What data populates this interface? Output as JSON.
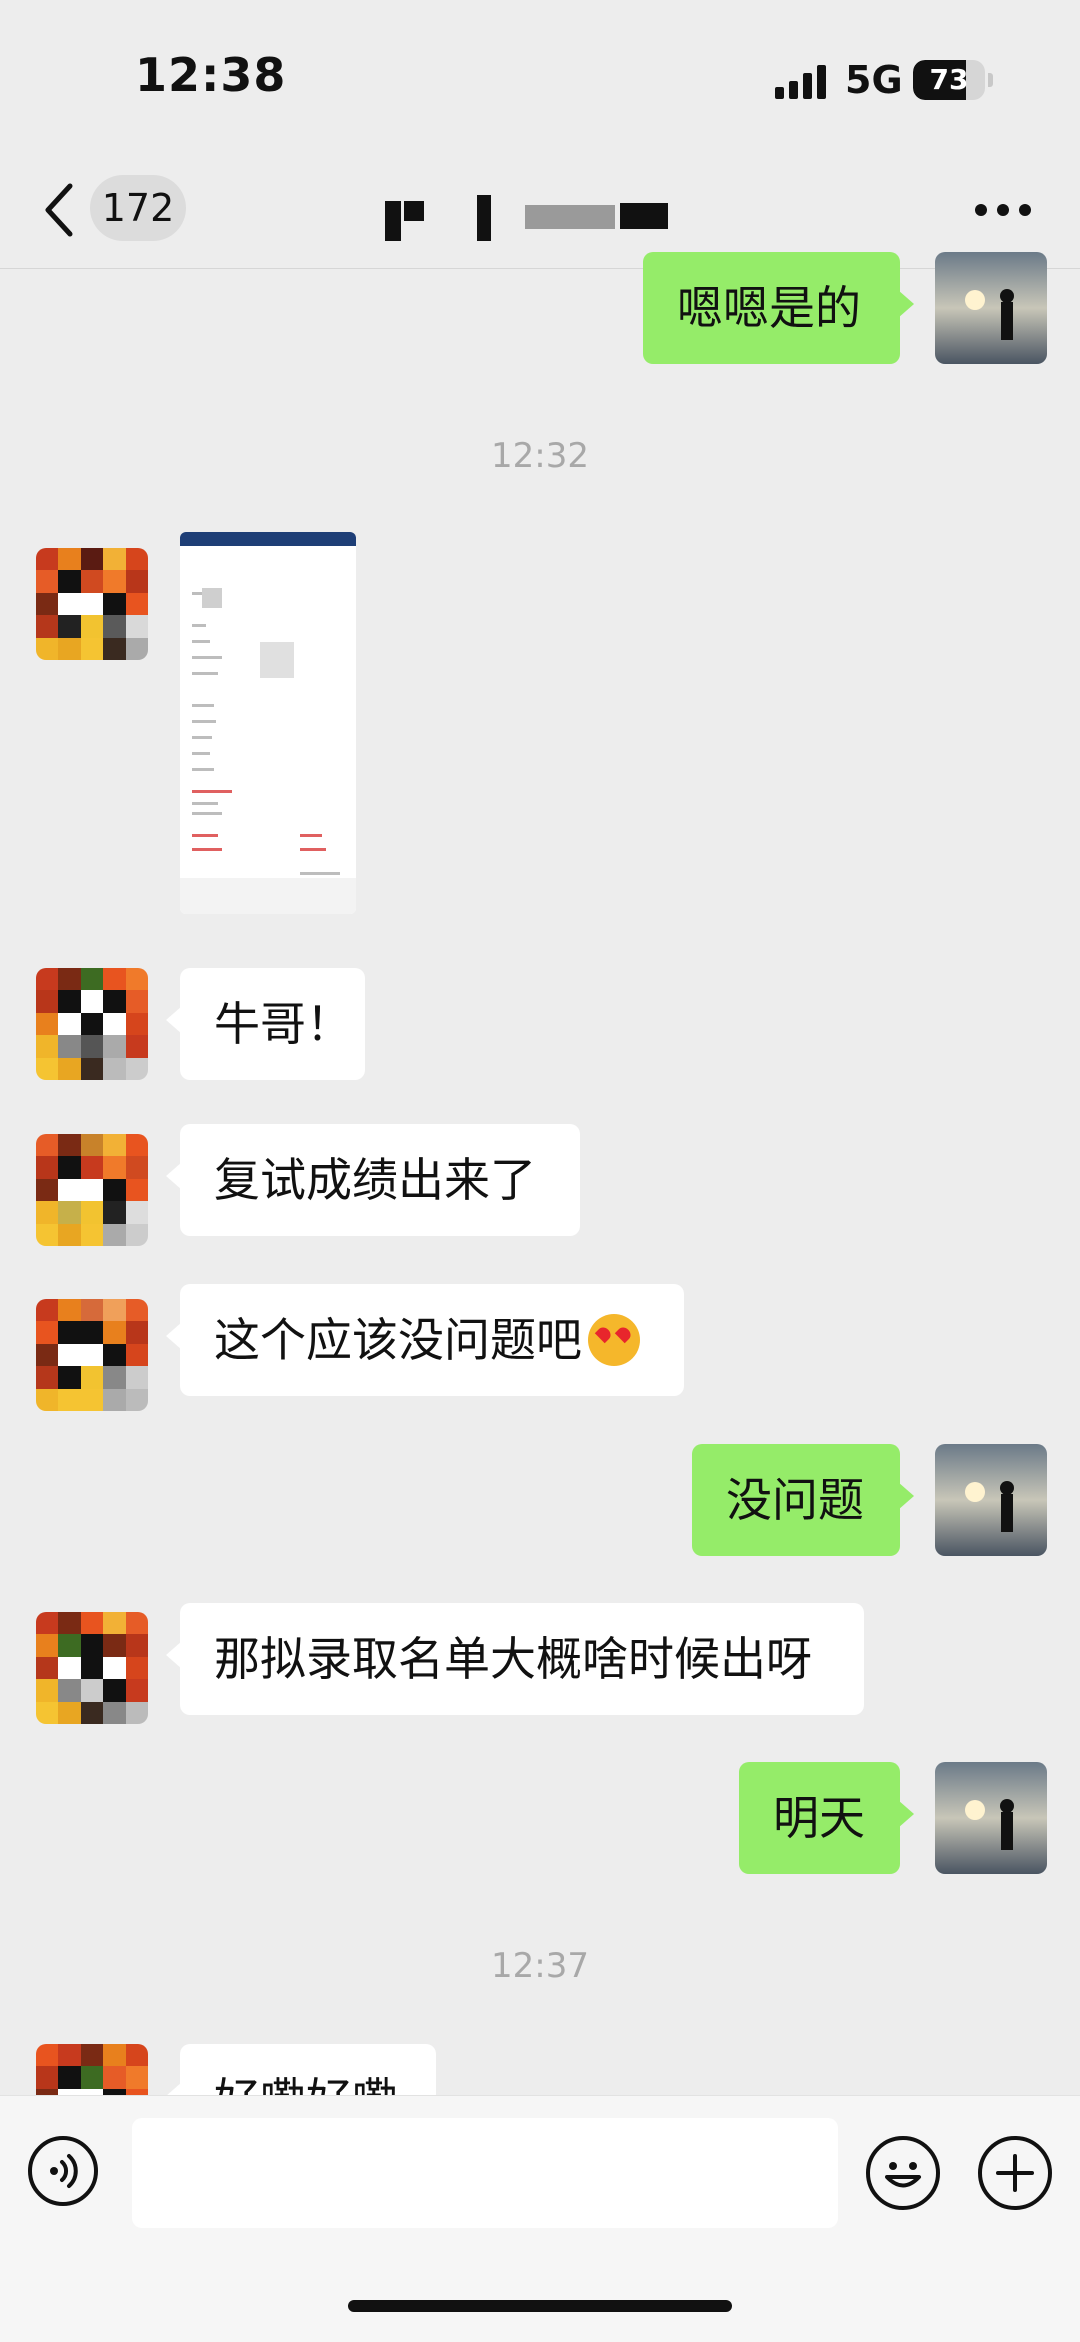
{
  "status_bar": {
    "time": "12:38",
    "network": "5G",
    "battery": "73",
    "battery_level_percent": 73,
    "signal_icon": "cellular-signal-icon",
    "battery_icon": "battery-icon"
  },
  "header": {
    "back_icon": "chevron-left-icon",
    "unread_count": "172",
    "more_icon": "more-dots-icon"
  },
  "messages": [
    {
      "type": "text",
      "direction": "out",
      "text": "嗯嗯是的"
    },
    {
      "type": "time",
      "text": "12:32"
    },
    {
      "type": "image",
      "direction": "in",
      "description_icon": "screenshot-thumbnail"
    },
    {
      "type": "text",
      "direction": "in",
      "text": "牛哥！"
    },
    {
      "type": "text",
      "direction": "in",
      "text": "复试成绩出来了"
    },
    {
      "type": "text",
      "direction": "in",
      "text": "这个应该没问题吧",
      "emoji": "heart-eyes-emoji-icon"
    },
    {
      "type": "text",
      "direction": "out",
      "text": "没问题"
    },
    {
      "type": "text",
      "direction": "in",
      "text": "那拟录取名单大概啥时候出呀"
    },
    {
      "type": "text",
      "direction": "out",
      "text": "明天"
    },
    {
      "type": "time",
      "text": "12:37"
    },
    {
      "type": "text",
      "direction": "in",
      "text": "好嘞好嘞"
    }
  ],
  "input_bar": {
    "voice_icon": "voice-icon",
    "input_value": "",
    "emoji_icon": "emoji-icon",
    "plus_icon": "plus-icon"
  },
  "colors": {
    "background": "#ededed",
    "outgoing_bubble": "#95ec69",
    "incoming_bubble": "#ffffff"
  }
}
